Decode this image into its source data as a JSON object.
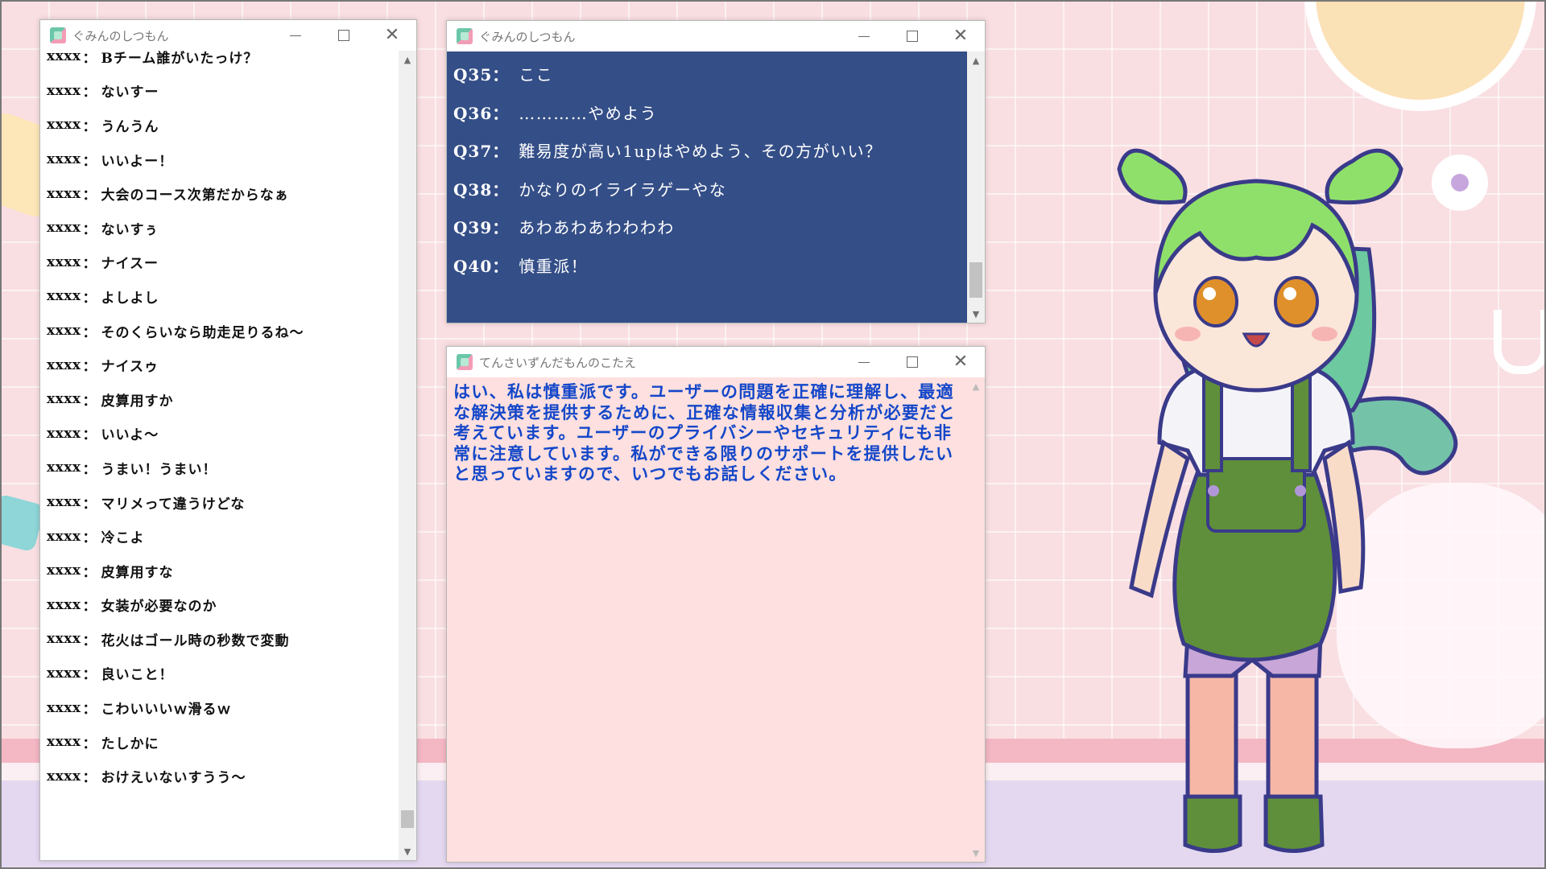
{
  "colors": {
    "question_bg": "#344e87",
    "answer_bg": "#fde0df",
    "answer_text": "#1447c9",
    "character_hair": "#8fe06a",
    "character_outfit": "#5f8f3a"
  },
  "chat_window": {
    "title": "ぐみんのしつもん",
    "icon": "app-icon",
    "messages": [
      {
        "user": "xxxx",
        "text": "Bチーム誰がいたっけ？"
      },
      {
        "user": "xxxx",
        "text": "ないすー"
      },
      {
        "user": "xxxx",
        "text": "うんうん"
      },
      {
        "user": "xxxx",
        "text": "いいよー！"
      },
      {
        "user": "xxxx",
        "text": "大会のコース次第だからなぁ"
      },
      {
        "user": "xxxx",
        "text": "ないすぅ"
      },
      {
        "user": "xxxx",
        "text": "ナイスー"
      },
      {
        "user": "xxxx",
        "text": "よしよし"
      },
      {
        "user": "xxxx",
        "text": "そのくらいなら助走足りるね～"
      },
      {
        "user": "xxxx",
        "text": "ナイスゥ"
      },
      {
        "user": "xxxx",
        "text": "皮算用すか"
      },
      {
        "user": "xxxx",
        "text": "いいよ～"
      },
      {
        "user": "xxxx",
        "text": "うまい！うまい！"
      },
      {
        "user": "xxxx",
        "text": "マリメって違うけどな"
      },
      {
        "user": "xxxx",
        "text": "冷こよ"
      },
      {
        "user": "xxxx",
        "text": "皮算用すな"
      },
      {
        "user": "xxxx",
        "text": "女装が必要なのか"
      },
      {
        "user": "xxxx",
        "text": "花火はゴール時の秒数で変動"
      },
      {
        "user": "xxxx",
        "text": "良いこと！"
      },
      {
        "user": "xxxx",
        "text": "こわいいいｗ滑るｗ"
      },
      {
        "user": "xxxx",
        "text": "たしかに"
      },
      {
        "user": "xxxx",
        "text": "おけえいないすうう～"
      }
    ]
  },
  "question_window": {
    "title": "ぐみんのしつもん",
    "icon": "app-icon",
    "questions": [
      {
        "id": "Q35：",
        "text": "ここ"
      },
      {
        "id": "Q36：",
        "text": "…………やめよう"
      },
      {
        "id": "Q37：",
        "text": "難易度が高い1upはやめよう、その方がいい？"
      },
      {
        "id": "Q38：",
        "text": "かなりのイライラゲーやな"
      },
      {
        "id": "Q39：",
        "text": "あわあわあわわわわ"
      },
      {
        "id": "Q40：",
        "text": "慎重派！"
      }
    ]
  },
  "answer_window": {
    "title": "てんさいずんだもんのこたえ",
    "icon": "app-icon",
    "text": "はい、私は慎重派です。ユーザーの問題を正確に理解し、最適な解決策を提供するために、正確な情報収集と分析が必要だと考えています。ユーザーのプライバシーやセキュリティにも非常に注意しています。私ができる限りのサポートを提供したいと思っていますので、いつでもお話しください。"
  },
  "window_controls": {
    "minimize_icon": "minimize-icon",
    "maximize_icon": "maximize-icon",
    "close_icon": "close-icon"
  }
}
